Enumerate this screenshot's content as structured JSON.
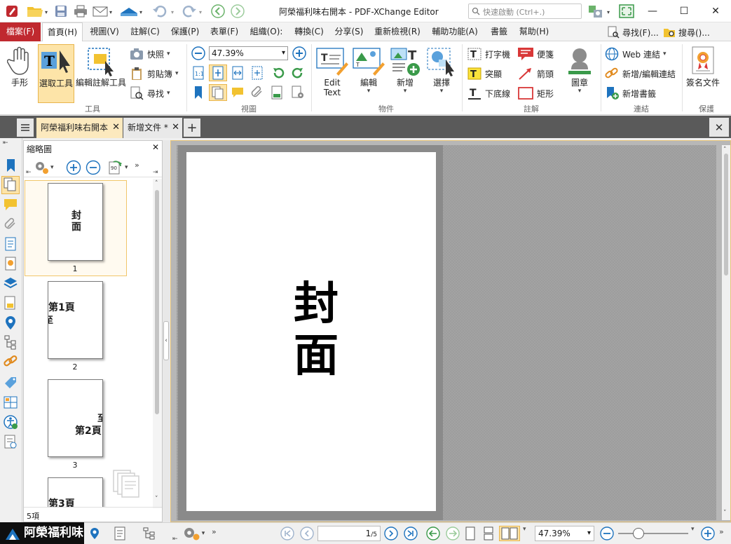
{
  "window": {
    "title": "阿榮福利味右開本 - PDF-XChange Editor",
    "search_placeholder": "快速啟動 (Ctrl+.)"
  },
  "menu": {
    "file": "檔案(F)",
    "items": [
      "首頁(H)",
      "視圖(V)",
      "註解(C)",
      "保護(P)",
      "表單(F)",
      "組織(O):",
      "轉換(C)",
      "分享(S)",
      "重新檢視(R)",
      "輔助功能(A)",
      "書籤",
      "幫助(H)"
    ],
    "find": "尋找(F)...",
    "search": "搜尋()..."
  },
  "ribbon": {
    "tools": {
      "hand": "手形",
      "select": "選取工具",
      "edit_annot": "編輯註解工具",
      "snapshot": "快照",
      "clipboard": "剪貼簿",
      "find": "尋找",
      "group": "工具"
    },
    "view": {
      "zoom": "47.39%",
      "group": "視圖"
    },
    "objects": {
      "edit_text_line1": "Edit",
      "edit_text_line2": "Text",
      "edit": "編輯",
      "add": "新增",
      "select": "選擇",
      "group": "物件"
    },
    "comments": {
      "typewriter": "打字機",
      "sticky": "便箋",
      "highlight": "突顯",
      "arrow": "箭頭",
      "underline": "下底線",
      "rectangle": "矩形",
      "group": "註解"
    },
    "stamp": {
      "label": "圖章"
    },
    "links": {
      "web": "Web 連結",
      "add_edit_link": "新增/編輯連結",
      "add_bookmark": "新增書籤",
      "group": "連結"
    },
    "protect": {
      "sign": "簽名文件",
      "group": "保護"
    }
  },
  "tabs": [
    {
      "label": "阿榮福利味右開本"
    },
    {
      "label": "新增文件 *"
    }
  ],
  "thumbnails": {
    "title": "縮略圖",
    "pages": [
      {
        "num": "1",
        "text": "封\n面"
      },
      {
        "num": "2",
        "text": "第1頁"
      },
      {
        "num": "3",
        "text": "第2頁"
      },
      {
        "num": "",
        "text": "第3頁"
      }
    ],
    "count": "5項"
  },
  "document": {
    "page_text": "封面"
  },
  "status": {
    "brand": "阿榮福利味",
    "page_current": "1",
    "page_total": "/5",
    "zoom": "47.39%"
  },
  "colors": {
    "accent_red": "#c0292f",
    "selected_tab": "#fce9be",
    "selected_button": "#fde4a8",
    "icon_blue": "#1e73be"
  }
}
